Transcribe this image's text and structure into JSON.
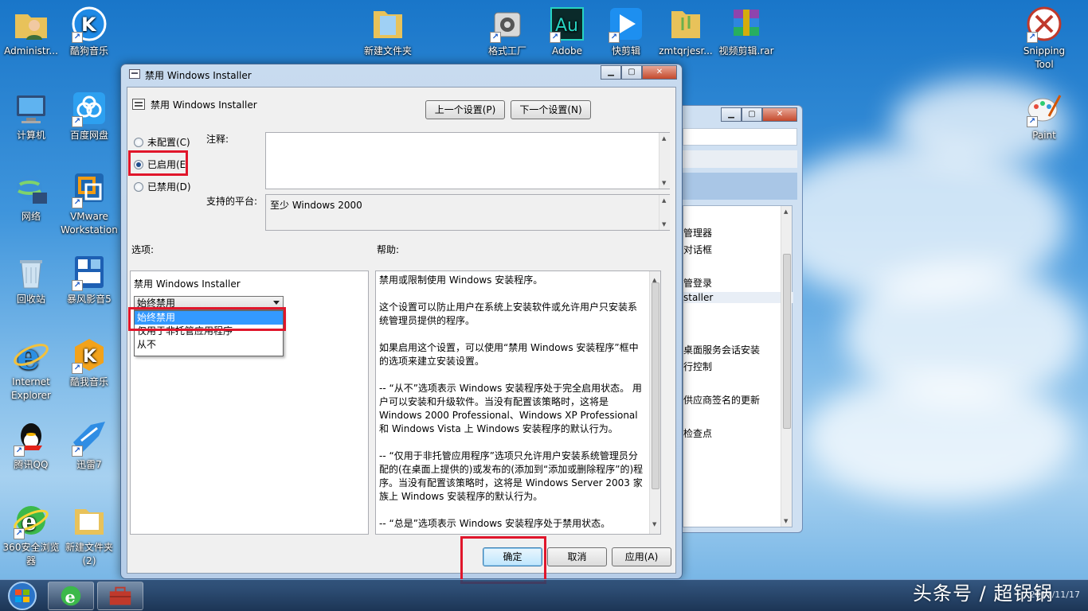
{
  "desktop": {
    "icons_left": [
      {
        "label": "Administr..."
      },
      {
        "label": "计算机"
      },
      {
        "label": "网络"
      },
      {
        "label": "回收站"
      },
      {
        "label": "Internet Explorer"
      },
      {
        "label": "腾讯QQ"
      },
      {
        "label": "360安全浏览器"
      }
    ],
    "icons_col2": [
      {
        "label": "酷狗音乐"
      },
      {
        "label": "百度网盘"
      },
      {
        "label": "VMware Workstation"
      },
      {
        "label": "暴风影音5"
      },
      {
        "label": "酷我音乐"
      },
      {
        "label": "迅雷7"
      },
      {
        "label": "新建文件夹 (2)"
      }
    ],
    "icons_top": [
      {
        "label": "新建文件夹"
      },
      {
        "label": "格式工厂"
      },
      {
        "label": "Adobe"
      },
      {
        "label": "快剪辑"
      },
      {
        "label": "zmtqrjesr..."
      },
      {
        "label": "视频剪辑.rar"
      }
    ],
    "icons_right": [
      {
        "label": "Snipping Tool"
      },
      {
        "label": "Paint"
      }
    ]
  },
  "background_window": {
    "items": [
      "管理器",
      "对话框",
      "管登录",
      "staller",
      "桌面服务会话安装",
      "行控制",
      "供应商签名的更新",
      "检查点"
    ]
  },
  "dialog": {
    "title": "禁用 Windows Installer",
    "setting_title": "禁用 Windows Installer",
    "prev_button": "上一个设置(P)",
    "next_button": "下一个设置(N)",
    "radio_not_configured": "未配置(C)",
    "radio_enabled": "已启用(E",
    "radio_disabled": "已禁用(D)",
    "comment_label": "注释:",
    "comment_value": "",
    "platform_label": "支持的平台:",
    "platform_value": "至少 Windows 2000",
    "options_label": "选项:",
    "help_label": "帮助:",
    "option_name": "禁用 Windows Installer",
    "combo_value": "始终禁用",
    "dropdown_options": [
      "始终禁用",
      "仅用于非托管应用程序",
      "从不"
    ],
    "help_paragraphs": [
      "禁用或限制使用 Windows 安装程序。",
      "这个设置可以防止用户在系统上安装软件或允许用户只安装系统管理员提供的程序。",
      "如果启用这个设置，可以使用“禁用 Windows 安装程序”框中的选项来建立安装设置。",
      "-- “从不”选项表示 Windows 安装程序处于完全启用状态。 用户可以安装和升级软件。当没有配置该策略时，这将是 Windows 2000 Professional、Windows XP Professional 和 Windows Vista 上 Windows 安装程序的默认行为。",
      "-- “仅用于非托管应用程序”选项只允许用户安装系统管理员分配的(在桌面上提供的)或发布的(添加到“添加或删除程序”的)程序。当没有配置该策略时，这将是 Windows Server 2003 家族上 Windows 安装程序的默认行为。",
      "-- “总是”选项表示 Windows 安装程序处于禁用状态。"
    ],
    "ok_button": "确定",
    "cancel_button": "取消",
    "apply_button": "应用(A)"
  },
  "taskbar": {
    "clock": "2017/11/17"
  },
  "watermark": "头条号 / 超锅锅"
}
